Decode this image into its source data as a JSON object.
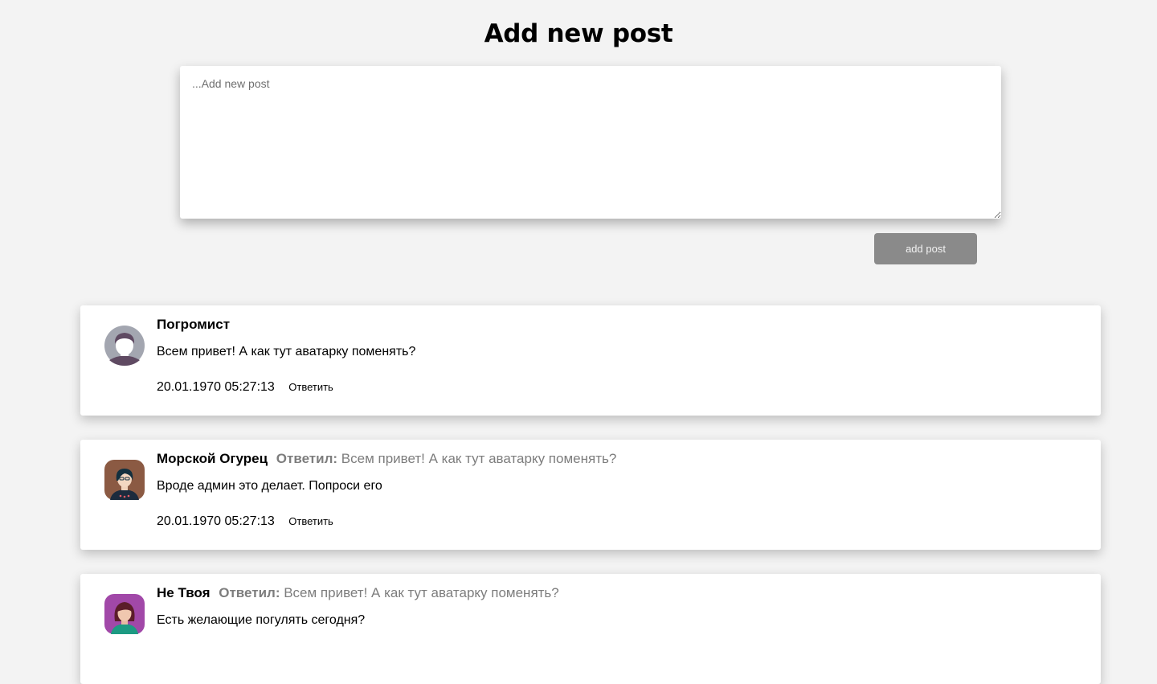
{
  "page": {
    "title": "Add new post"
  },
  "composer": {
    "placeholder": "...Add new post",
    "value": "",
    "submit_label": "add post"
  },
  "posts": [
    {
      "author": "Погромист",
      "avatar_icon": "user-avatar-gray-icon",
      "reply_label": "",
      "reply_to": "",
      "text": "Всем привет! А как тут аватарку поменять?",
      "date": "20.01.1970 05:27:13",
      "reply_action": "Ответить"
    },
    {
      "author": "Морской Огурец",
      "avatar_icon": "user-avatar-brown-icon",
      "reply_label": "Ответил:",
      "reply_to": "Всем привет! А как тут аватарку поменять?",
      "text": "Вроде админ это делает. Попроси его",
      "date": "20.01.1970 05:27:13",
      "reply_action": "Ответить"
    },
    {
      "author": "Не Твоя",
      "avatar_icon": "user-avatar-purple-icon",
      "reply_label": "Ответил:",
      "reply_to": "Всем привет! А как тут аватарку поменять?",
      "text": "Есть желающие погулять сегодня?",
      "date": "",
      "reply_action": ""
    }
  ],
  "colors": {
    "background": "#f3f3f3",
    "button_bg": "#8a8a8a",
    "muted_text": "#7d7d7d"
  }
}
